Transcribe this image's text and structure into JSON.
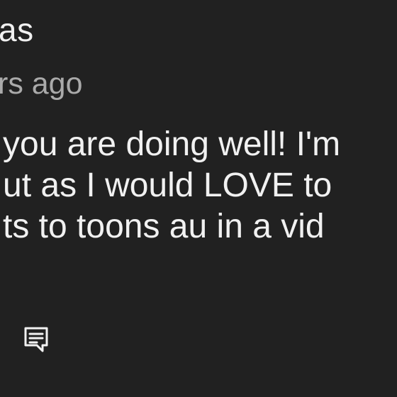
{
  "comment": {
    "author": "as",
    "timestamp": "rs ago",
    "text_lines": [
      "you are doing well! I'm",
      "ut as I would LOVE to",
      "ts to toons au in a vid"
    ]
  },
  "icons": {
    "reply": "comment-reply-icon"
  },
  "colors": {
    "background": "#212121",
    "primary_text": "#f1f1f1",
    "secondary_text": "#aaaaaa"
  }
}
